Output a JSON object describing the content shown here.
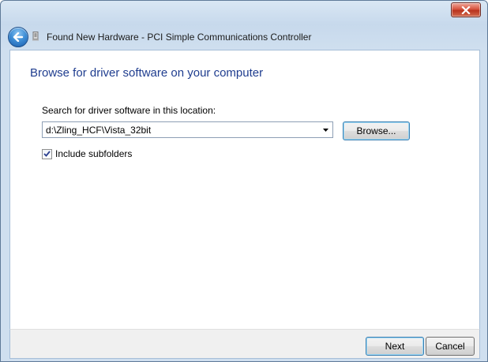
{
  "window": {
    "title": "Found New Hardware - PCI Simple Communications Controller",
    "close_icon": "close-icon",
    "back_icon": "back-arrow-icon",
    "hardware_icon": "hardware-device-icon"
  },
  "page": {
    "heading": "Browse for driver software on your computer",
    "search_label": "Search for driver software in this location:",
    "path_value": "d:\\Zling_HCF\\Vista_32bit",
    "browse_label": "Browse...",
    "include_subfolders_label": "Include subfolders",
    "include_subfolders_checked": true
  },
  "footer": {
    "next_label": "Next",
    "cancel_label": "Cancel"
  },
  "colors": {
    "heading": "#1f3d8f",
    "titlebar": "#c7d9ec",
    "close_button": "#c7412b",
    "focus_border": "#3c7fb1"
  }
}
